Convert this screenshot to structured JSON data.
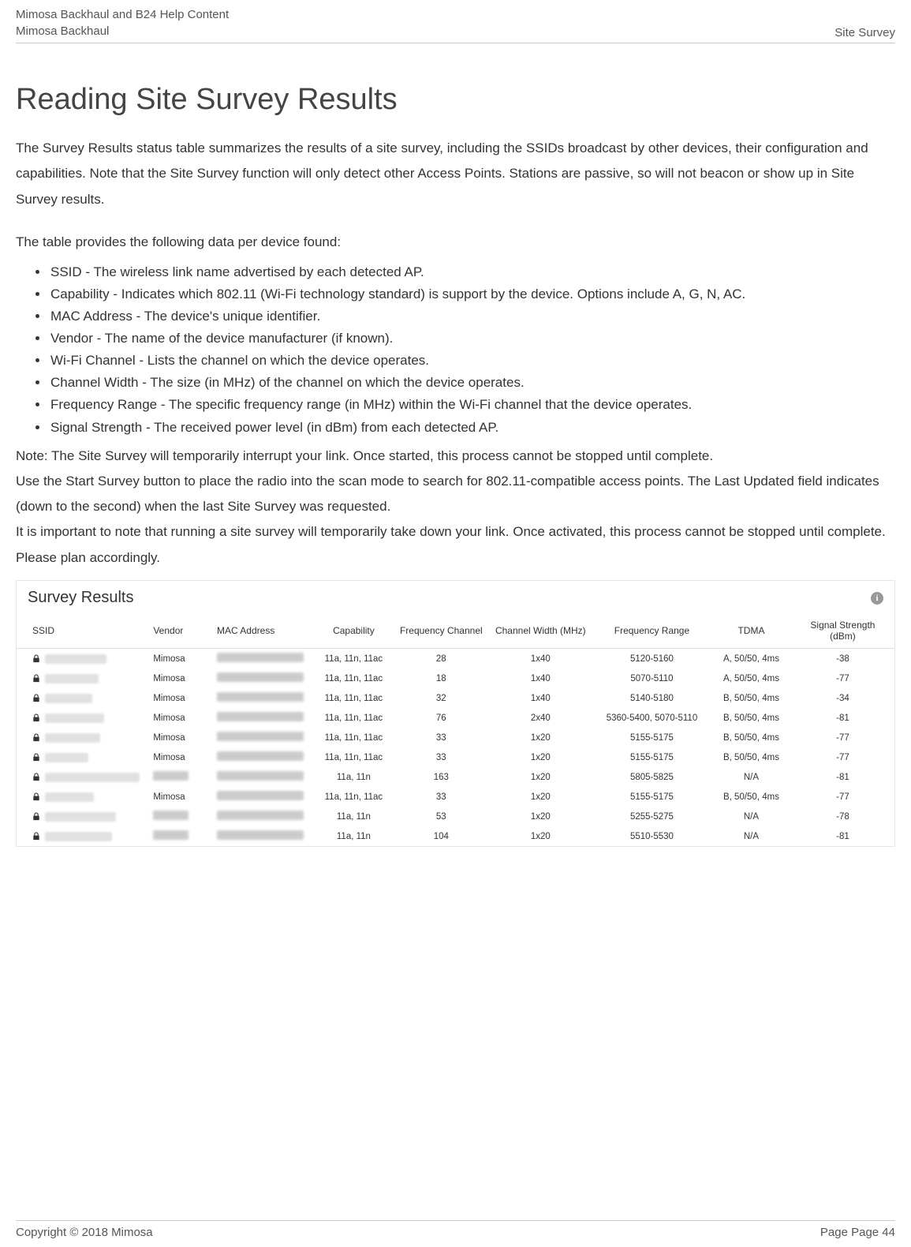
{
  "header": {
    "line1": "Mimosa Backhaul and B24 Help Content",
    "line2": "Mimosa Backhaul",
    "right": "Site Survey"
  },
  "title": "Reading Site Survey Results",
  "intro_paragraph": "The Survey Results status table summarizes the results of a site survey, including the SSIDs broadcast by other devices, their configuration and capabilities. Note that the Site Survey function will only detect other Access Points. Stations are passive, so will not beacon or show up in Site Survey results.",
  "intro_paragraph2": "The table provides the following data per device found:",
  "bullets": [
    "SSID - The wireless link name advertised by each detected AP.",
    "Capability - Indicates which 802.11 (Wi-Fi technology standard) is support by the device. Options include A, G, N, AC.",
    "MAC Address - The device's unique identifier.",
    "Vendor - The name of the device manufacturer (if known).",
    "Wi-Fi Channel - Lists the channel on which the device operates.",
    "Channel Width - The size (in MHz) of the channel on which the device operates.",
    "Frequency Range - The specific frequency range (in MHz) within the Wi-Fi channel that the device operates.",
    "Signal Strength - The received power level (in dBm) from each detected AP."
  ],
  "note_paragraph": "Note: The Site Survey will temporarily interrupt your link. Once started, this process cannot be stopped until complete.",
  "start_paragraph": "Use the Start Survey button to place the radio into the scan mode to search for 802.11-compatible access points. The Last Updated field indicates (down to the second) when the last Site Survey was requested.",
  "important_paragraph": "It is important to note that running a site survey will temporarily take down your link. Once activated, this process cannot be stopped until complete. Please plan accordingly.",
  "panel_title": "Survey Results",
  "table": {
    "headers": {
      "ssid": "SSID",
      "vendor": "Vendor",
      "mac": "MAC Address",
      "capability": "Capability",
      "channel": "Frequency Channel",
      "width": "Channel Width (MHz)",
      "range": "Frequency Range",
      "tdma": "TDMA",
      "signal": "Signal Strength (dBm)"
    },
    "rows": [
      {
        "vendor": "Mimosa",
        "capability": "11a, 11n, 11ac",
        "channel": "28",
        "width": "1x40",
        "range": "5120-5160",
        "tdma": "A, 50/50, 4ms",
        "signal": "-38",
        "ssid_w": 78,
        "mac_w": 110
      },
      {
        "vendor": "Mimosa",
        "capability": "11a, 11n, 11ac",
        "channel": "18",
        "width": "1x40",
        "range": "5070-5110",
        "tdma": "A, 50/50, 4ms",
        "signal": "-77",
        "ssid_w": 68,
        "mac_w": 110
      },
      {
        "vendor": "Mimosa",
        "capability": "11a, 11n, 11ac",
        "channel": "32",
        "width": "1x40",
        "range": "5140-5180",
        "tdma": "B, 50/50, 4ms",
        "signal": "-34",
        "ssid_w": 60,
        "mac_w": 110
      },
      {
        "vendor": "Mimosa",
        "capability": "11a, 11n, 11ac",
        "channel": "76",
        "width": "2x40",
        "range": "5360-5400, 5070-5110",
        "tdma": "B, 50/50, 4ms",
        "signal": "-81",
        "ssid_w": 75,
        "mac_w": 110
      },
      {
        "vendor": "Mimosa",
        "capability": "11a, 11n, 11ac",
        "channel": "33",
        "width": "1x20",
        "range": "5155-5175",
        "tdma": "B, 50/50, 4ms",
        "signal": "-77",
        "ssid_w": 70,
        "mac_w": 110
      },
      {
        "vendor": "Mimosa",
        "capability": "11a, 11n, 11ac",
        "channel": "33",
        "width": "1x20",
        "range": "5155-5175",
        "tdma": "B, 50/50, 4ms",
        "signal": "-77",
        "ssid_w": 55,
        "mac_w": 110
      },
      {
        "vendor": "",
        "vendor_blurred": true,
        "capability": "11a, 11n",
        "channel": "163",
        "width": "1x20",
        "range": "5805-5825",
        "tdma": "N/A",
        "signal": "-81",
        "ssid_w": 120,
        "mac_w": 110
      },
      {
        "vendor": "Mimosa",
        "capability": "11a, 11n, 11ac",
        "channel": "33",
        "width": "1x20",
        "range": "5155-5175",
        "tdma": "B, 50/50, 4ms",
        "signal": "-77",
        "ssid_w": 62,
        "mac_w": 110
      },
      {
        "vendor": "",
        "vendor_blurred": true,
        "capability": "11a, 11n",
        "channel": "53",
        "width": "1x20",
        "range": "5255-5275",
        "tdma": "N/A",
        "signal": "-78",
        "ssid_w": 90,
        "mac_w": 110
      },
      {
        "vendor": "",
        "vendor_blurred": true,
        "capability": "11a, 11n",
        "channel": "104",
        "width": "1x20",
        "range": "5510-5530",
        "tdma": "N/A",
        "signal": "-81",
        "ssid_w": 85,
        "mac_w": 110
      }
    ]
  },
  "footer": {
    "left": "Copyright © 2018 Mimosa",
    "right": "Page Page 44"
  }
}
